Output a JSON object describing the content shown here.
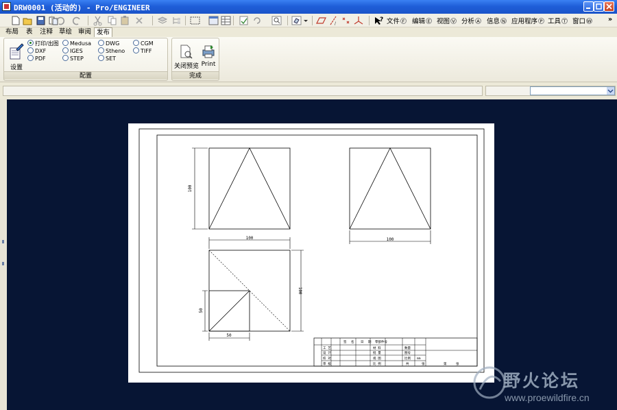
{
  "window": {
    "title": "DRW0001 (活动的) - Pro/ENGINEER"
  },
  "menu": [
    {
      "label": "文件",
      "key": "F"
    },
    {
      "label": "编辑",
      "key": "E"
    },
    {
      "label": "视图",
      "key": "V"
    },
    {
      "label": "分析",
      "key": "A"
    },
    {
      "label": "信息",
      "key": "N"
    },
    {
      "label": "应用程序",
      "key": "P"
    },
    {
      "label": "工具",
      "key": "T"
    },
    {
      "label": "窗口",
      "key": "W"
    }
  ],
  "overflow": "»",
  "ribbon_tabs": [
    "布局",
    "表",
    "注释",
    "草绘",
    "审阅",
    "发布"
  ],
  "ribbon_active_tab": "发布",
  "settings_group": {
    "setup_label": "设置",
    "label": "配置",
    "formats": [
      {
        "label": "打印/出图",
        "checked": true
      },
      {
        "label": "DXF"
      },
      {
        "label": "PDF"
      },
      {
        "label": "Medusa"
      },
      {
        "label": "IGES"
      },
      {
        "label": "STEP"
      },
      {
        "label": "DWG"
      },
      {
        "label": "Stheno"
      },
      {
        "label": "SET"
      },
      {
        "label": "CGM"
      },
      {
        "label": "TIFF"
      }
    ]
  },
  "finish_group": {
    "label": "完成",
    "close_preview": "关闭预览",
    "print": "Print"
  },
  "drawing": {
    "dims": {
      "front_height": "100",
      "top_width": "100",
      "bottom_width": "100",
      "bottom_height": "100",
      "inner_height": "50",
      "inner_width": "50"
    },
    "title_block": {
      "header": [
        "签",
        "名",
        "日",
        "期",
        "零部件号"
      ],
      "rows": [
        "工 艺",
        "设 计",
        "校 对",
        "审 核"
      ],
      "right_labels": [
        "材 料",
        "批 量",
        "视 图",
        "比 例"
      ],
      "right_values": [
        "数量",
        "图号",
        "比例",
        "mm"
      ],
      "footer": [
        "共",
        "张",
        "第",
        "张"
      ]
    }
  },
  "watermark": {
    "text": "野火论坛",
    "url": "www.proewildfire.cn"
  }
}
